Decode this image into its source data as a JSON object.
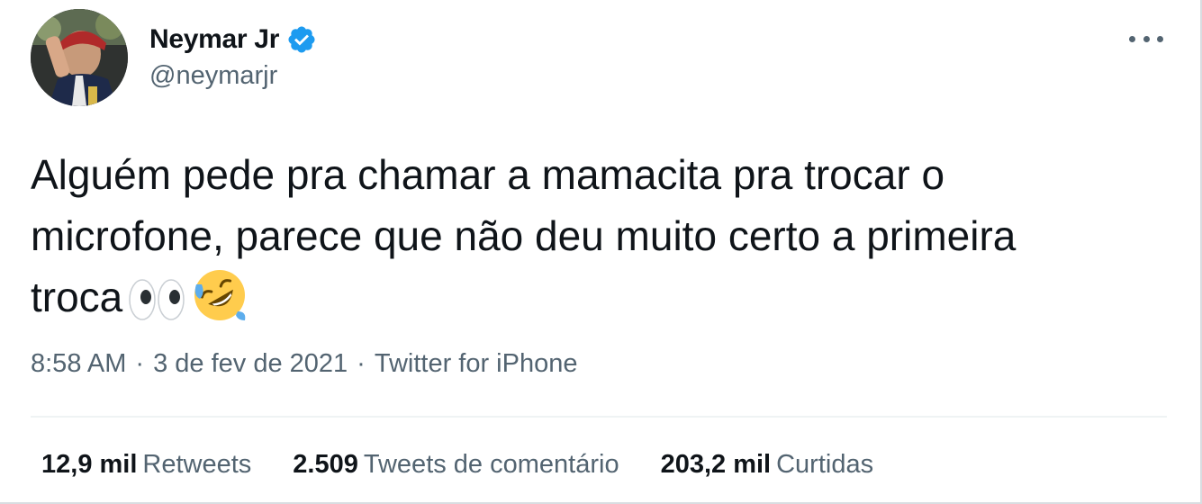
{
  "user": {
    "display_name": "Neymar Jr",
    "handle": "@neymarjr",
    "verified": true,
    "avatar": "profile-photo"
  },
  "tweet": {
    "lines": [
      "Alguém pede pra chamar a mamacita pra trocar o",
      "microfone, parece que não deu muito certo a primeira",
      "troca"
    ],
    "emojis": [
      "eyes-emoji",
      "rolling-on-floor-laughing-emoji"
    ]
  },
  "meta": {
    "time": "8:58 AM",
    "separator": "·",
    "date": "3 de fev de 2021",
    "source": "Twitter for iPhone"
  },
  "stats": {
    "retweets_count": "12,9 mil",
    "retweets_label": "Retweets",
    "quotes_count": "2.509",
    "quotes_label": "Tweets de comentário",
    "likes_count": "203,2 mil",
    "likes_label": "Curtidas"
  },
  "colors": {
    "text": "#0f1419",
    "secondary": "#536471",
    "verified": "#1d9bf0",
    "divider": "#eff3f4"
  }
}
